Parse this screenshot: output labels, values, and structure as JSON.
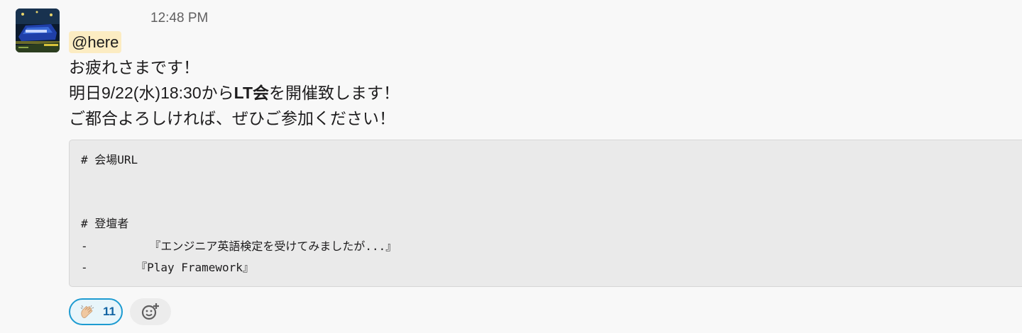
{
  "message": {
    "timestamp": "12:48 PM",
    "mention": "@here",
    "lines": [
      "お疲れさまです！",
      {
        "pre": "明日9/22(水)18:30から",
        "bold": "LT会",
        "post": "を開催致します！"
      },
      "ご都合よろしければ、ぜひご参加ください！"
    ],
    "code_block": [
      "# 会場URL",
      "",
      "",
      "",
      "# 登壇者",
      "-         『エンジニア英語検定を受けてみましたが...』",
      "-       『Play Framework』"
    ]
  },
  "reactions": [
    {
      "emoji": "clapping-hands",
      "count": "11",
      "active": true
    }
  ],
  "add_reaction": {
    "icon": "add-emoji-icon"
  },
  "colors": {
    "mention_bg": "#fcecc2",
    "reaction_border": "#1d9bd1",
    "reaction_bg": "#e8f5fa",
    "reaction_count": "#1264a3",
    "code_bg": "#eaeaea"
  }
}
